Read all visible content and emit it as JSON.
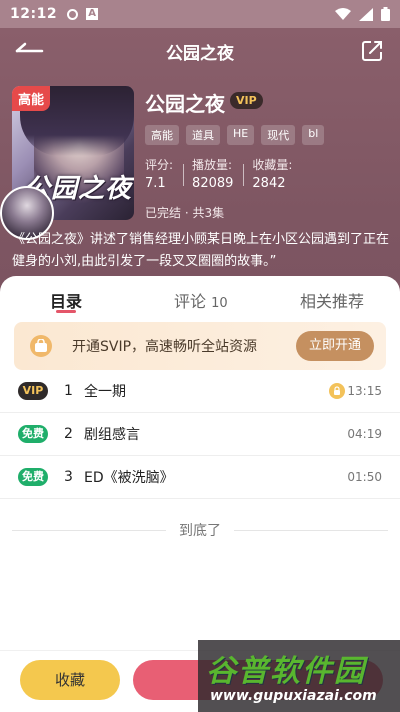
{
  "status_bar": {
    "time": "12:12",
    "indicator": "A"
  },
  "header": {
    "title": "公园之夜"
  },
  "book": {
    "cover_badge": "高能",
    "cover_title": "公园之夜",
    "title": "公园之夜",
    "vip_label": "VIP",
    "tags": [
      "高能",
      "道具",
      "HE",
      "现代",
      "bl"
    ],
    "stats": [
      {
        "label": "评分:",
        "value": "7.1"
      },
      {
        "label": "播放量:",
        "value": "82089"
      },
      {
        "label": "收藏量:",
        "value": "2842"
      }
    ],
    "status": "已完结 · 共3集",
    "description": "《公园之夜》讲述了销售经理小顾某日晚上在小区公园遇到了正在健身的小刘,由此引发了一段叉叉圈圈的故事。”"
  },
  "tabs": [
    {
      "label": "目录",
      "active": true
    },
    {
      "label": "评论",
      "count": "10",
      "active": false
    },
    {
      "label": "相关推荐",
      "active": false
    }
  ],
  "promo": {
    "text": "开通SVIP，高速畅听全站资源",
    "button": "立即开通",
    "icon": "vip-bag-icon"
  },
  "episodes": [
    {
      "badge": "VIP",
      "badge_type": "vip",
      "number": "1",
      "title": "全一期",
      "locked": true,
      "duration": "13:15"
    },
    {
      "badge": "免费",
      "badge_type": "free",
      "number": "2",
      "title": "剧组感言",
      "locked": false,
      "duration": "04:19"
    },
    {
      "badge": "免费",
      "badge_type": "free",
      "number": "3",
      "title": "ED《被洗脑》",
      "locked": false,
      "duration": "01:50"
    }
  ],
  "list_end": "到底了",
  "bottom": {
    "collect": "收藏"
  },
  "watermark": {
    "name": "谷普软件园",
    "url": "www.gupuxiazai.com"
  },
  "colors": {
    "hero": "#7e5662",
    "accent": "#e45669",
    "vip_gold": "#f3c25a",
    "free_green": "#1fae6a",
    "collect_yellow": "#f4c84e",
    "play_pink": "#e85f74"
  }
}
